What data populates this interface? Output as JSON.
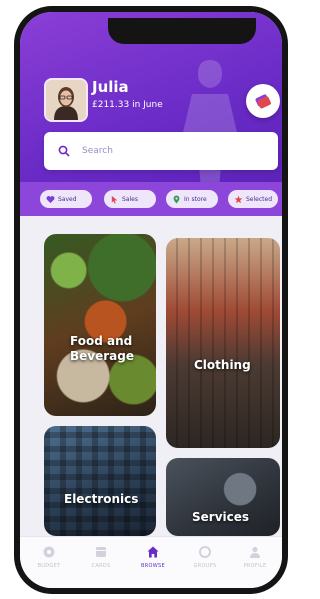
{
  "user": {
    "name": "Julia",
    "balance_text": "£211.33 in June"
  },
  "search": {
    "placeholder": "Search"
  },
  "filters": [
    {
      "label": "Saved",
      "icon": "heart-icon",
      "color": "#7b3fd6"
    },
    {
      "label": "Sales",
      "icon": "cursor-icon",
      "color": "#e0484f"
    },
    {
      "label": "In store",
      "icon": "location-pin-icon",
      "color": "#2f9b57"
    },
    {
      "label": "Selected",
      "icon": "star-icon",
      "color": "#e0484f"
    }
  ],
  "categories": [
    {
      "label": "Food and Beverage"
    },
    {
      "label": "Clothing"
    },
    {
      "label": "Electronics"
    },
    {
      "label": "Services"
    }
  ],
  "tabs": [
    {
      "label": "BUDGET",
      "icon": "wallet-icon",
      "active": false
    },
    {
      "label": "CARDS",
      "icon": "cards-icon",
      "active": false
    },
    {
      "label": "BROWSE",
      "icon": "home-icon",
      "active": true
    },
    {
      "label": "GROUPS",
      "icon": "groups-icon",
      "active": false
    },
    {
      "label": "PROFILE",
      "icon": "profile-icon",
      "active": false
    }
  ],
  "colors": {
    "primary": "#6a2bc7",
    "header": "#8b3fd6",
    "background": "#f0eff5"
  }
}
